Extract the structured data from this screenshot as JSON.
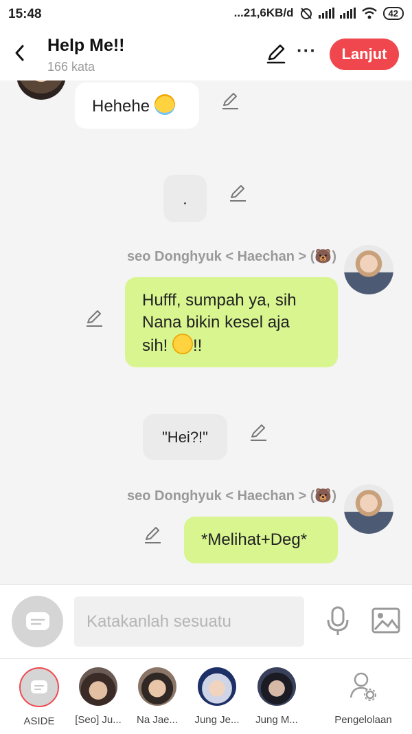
{
  "status_bar": {
    "time": "15:48",
    "network": "...21,6KB/d",
    "battery": "42"
  },
  "header": {
    "title": "Help Me!!",
    "word_count": "166 kata",
    "next_label": "Lanjut",
    "more_label": "···",
    "accent": "#f0474e"
  },
  "messages": {
    "m1": {
      "text": "Hehehe",
      "emoji": "smiling-face-with-halo"
    },
    "m2": {
      "text": "."
    },
    "m3": {
      "sender": "seo Donghyuk < Haechan > (🐻)",
      "line1": "Hufff, sumpah ya, sih",
      "line2": "Nana bikin kesel aja",
      "line3_before": "sih! ",
      "line3_after": "!!",
      "emoji": "slightly-smiling-face"
    },
    "m4": {
      "text": "\"Hei?!\""
    },
    "m5": {
      "sender": "seo Donghyuk < Haechan > (🐻)",
      "text": "*Melihat+Deg*"
    }
  },
  "input": {
    "placeholder": "Katakanlah sesuatu"
  },
  "characters": [
    {
      "label": "ASIDE"
    },
    {
      "label": "[Seo] Ju..."
    },
    {
      "label": "Na Jae..."
    },
    {
      "label": "Jung Je..."
    },
    {
      "label": "Jung M..."
    },
    {
      "label": "Pengelolaan"
    }
  ],
  "colors": {
    "bubble_green": "#d8f590",
    "bubble_grey": "#ebebeb",
    "background": "#f4f4f4"
  }
}
